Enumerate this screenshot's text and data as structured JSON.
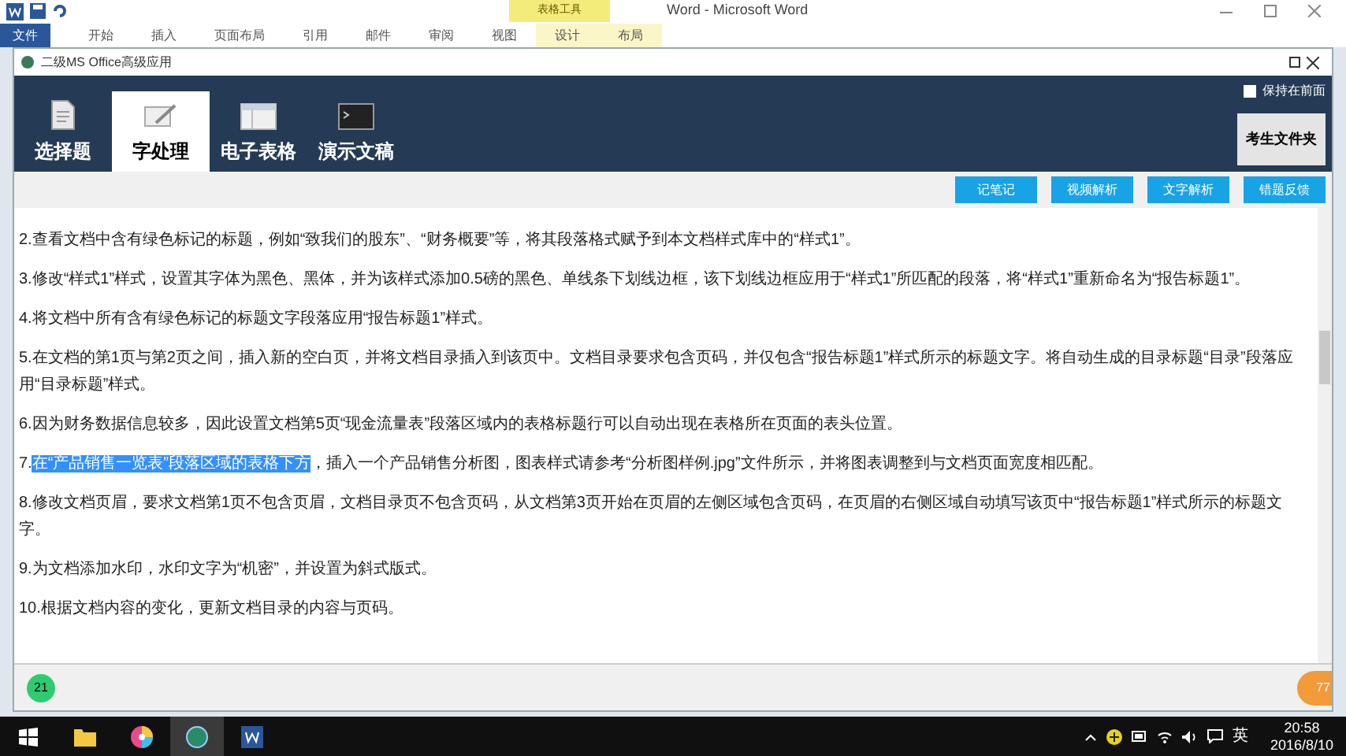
{
  "word_window": {
    "title": "Word - Microsoft Word",
    "contextual_tab": "表格工具",
    "ribbon_tabs": [
      {
        "label": "文件",
        "selected": true
      },
      {
        "label": "开始",
        "selected": false
      },
      {
        "label": "插入",
        "selected": false
      },
      {
        "label": "页面布局",
        "selected": false
      },
      {
        "label": "引用",
        "selected": false
      },
      {
        "label": "邮件",
        "selected": false
      },
      {
        "label": "审阅",
        "selected": false
      },
      {
        "label": "视图",
        "selected": false
      },
      {
        "label": "设计",
        "selected": false
      },
      {
        "label": "布局",
        "selected": false
      }
    ]
  },
  "app": {
    "title": "二级MS Office高级应用",
    "nav_tabs": [
      {
        "label": "选择题",
        "selected": false
      },
      {
        "label": "字处理",
        "selected": true
      },
      {
        "label": "电子表格",
        "selected": false
      },
      {
        "label": "演示文稿",
        "selected": false
      }
    ],
    "keep_on_top": {
      "label": "保持在前面",
      "checked": false
    },
    "folder_button": "考生文件夹",
    "toolbar_buttons": [
      "记笔记",
      "视频解析",
      "文字解析",
      "错题反馈"
    ],
    "instructions": [
      {
        "text": "2.查看文档中含有绿色标记的标题，例如“致我们的股东”、“财务概要”等，将其段落格式赋予到本文档样式库中的“样式1”。"
      },
      {
        "text": "3.修改“样式1”样式，设置其字体为黑色、黑体，并为该样式添加0.5磅的黑色、单线条下划线边框，该下划线边框应用于“样式1”所匹配的段落，将“样式1”重新命名为“报告标题1”。"
      },
      {
        "text": "4.将文档中所有含有绿色标记的标题文字段落应用“报告标题1”样式。"
      },
      {
        "text": "5.在文档的第1页与第2页之间，插入新的空白页，并将文档目录插入到该页中。文档目录要求包含页码，并仅包含“报告标题1”样式所示的标题文字。将自动生成的目录标题“目录”段落应用“目录标题”样式。"
      },
      {
        "text": "6.因为财务数据信息较多，因此设置文档第5页“现金流量表”段落区域内的表格标题行可以自动出现在表格所在页面的表头位置。"
      },
      {
        "prefix": "7.",
        "selected_text": "在“产品销售一览表”段落区域的表格下方",
        "text": "，插入一个产品销售分析图，图表样式请参考“分析图样例.jpg”文件所示，并将图表调整到与文档页面宽度相匹配。"
      },
      {
        "text": "8.修改文档页眉，要求文档第1页不包含页眉，文档目录页不包含页码，从文档第3页开始在页眉的左侧区域包含页码，在页眉的右侧区域自动填写该页中“报告标题1”样式所示的标题文字。"
      },
      {
        "text": "9.为文档添加水印，水印文字为“机密”，并设置为斜式版式。"
      },
      {
        "text": "10.根据文档内容的变化，更新文档目录的内容与页码。"
      }
    ],
    "question_number": "21",
    "score_badge": "77"
  },
  "taskbar": {
    "input_method": "英",
    "time": "20:58",
    "date": "2016/8/10"
  }
}
